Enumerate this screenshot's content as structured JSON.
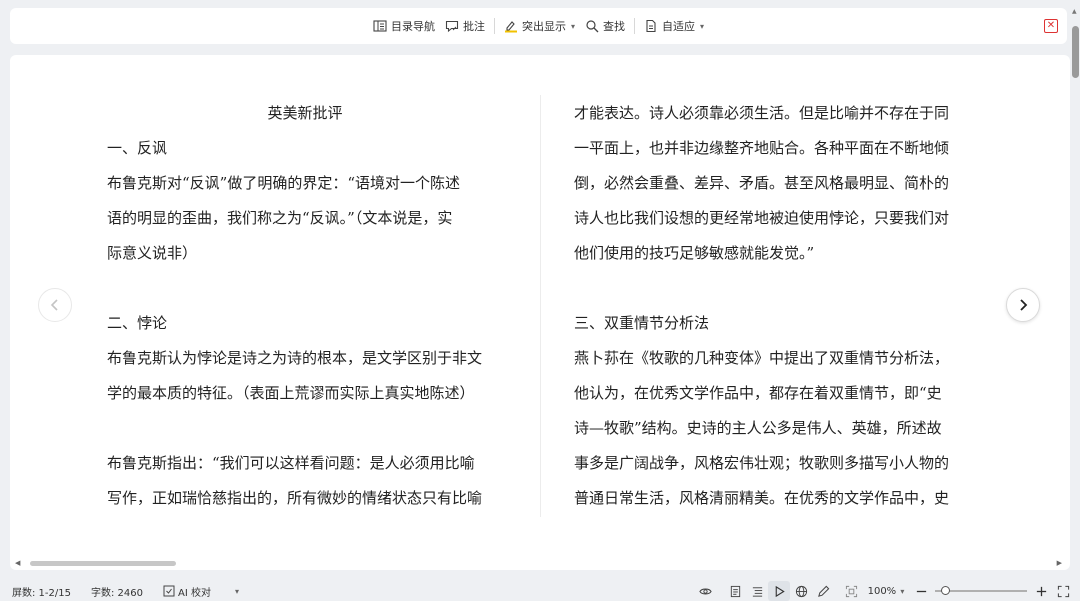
{
  "toolbar": {
    "toc_label": "目录导航",
    "comment_label": "批注",
    "highlight_label": "突出显示",
    "find_label": "查找",
    "fit_label": "自适应",
    "colors": {
      "highlight_accent": "#f2c200",
      "close": "#dd3333"
    }
  },
  "document": {
    "left_column": [
      "英美新批评",
      "一、反讽",
      "布鲁克斯对“反讽”做了明确的界定：“语境对一个陈述",
      "语的明显的歪曲，我们称之为“反讽。”（文本说是，实",
      "际意义说非）",
      "",
      "二、悖论",
      "布鲁克斯认为悖论是诗之为诗的根本，是文学区别于非文",
      "学的最本质的特征。（表面上荒谬而实际上真实地陈述）",
      "",
      "布鲁克斯指出：“我们可以这样看问题：是人必须用比喻",
      "写作，正如瑞恰慈指出的，所有微妙的情绪状态只有比喻"
    ],
    "right_column": [
      "才能表达。诗人必须靠必须生活。但是比喻并不存在于同",
      "一平面上，也并非边缘整齐地贴合。各种平面在不断地倾",
      "倒，必然会重叠、差异、矛盾。甚至风格最明显、简朴的",
      "诗人也比我们设想的更经常地被迫使用悖论，只要我们对",
      "他们使用的技巧足够敏感就能发觉。”",
      "",
      "三、双重情节分析法",
      "燕卜荪在《牧歌的几种变体》中提出了双重情节分析法，",
      "他认为，在优秀文学作品中，都存在着双重情节，即“史",
      "诗—牧歌”结构。史诗的主人公多是伟人、英雄，所述故",
      "事多是广阔战争，风格宏伟壮观；牧歌则多描写小人物的",
      "普通日常生活，风格清丽精美。在优秀的文学作品中，史"
    ]
  },
  "statusbar": {
    "screens": "屏数: 1-2/15",
    "word_count": "字数: 2460",
    "ai_check": "AI 校对",
    "zoom": "100%"
  },
  "icons": [
    "toc-icon",
    "comment-icon",
    "highlight-icon",
    "search-icon",
    "fit-page-icon",
    "close-icon",
    "prev-page-icon",
    "next-page-icon",
    "eye-icon",
    "page-view-icon",
    "outline-icon",
    "play-icon",
    "globe-icon",
    "pen-icon",
    "screenshot-icon",
    "zoom-out-icon",
    "zoom-in-icon",
    "fullscreen-icon"
  ]
}
